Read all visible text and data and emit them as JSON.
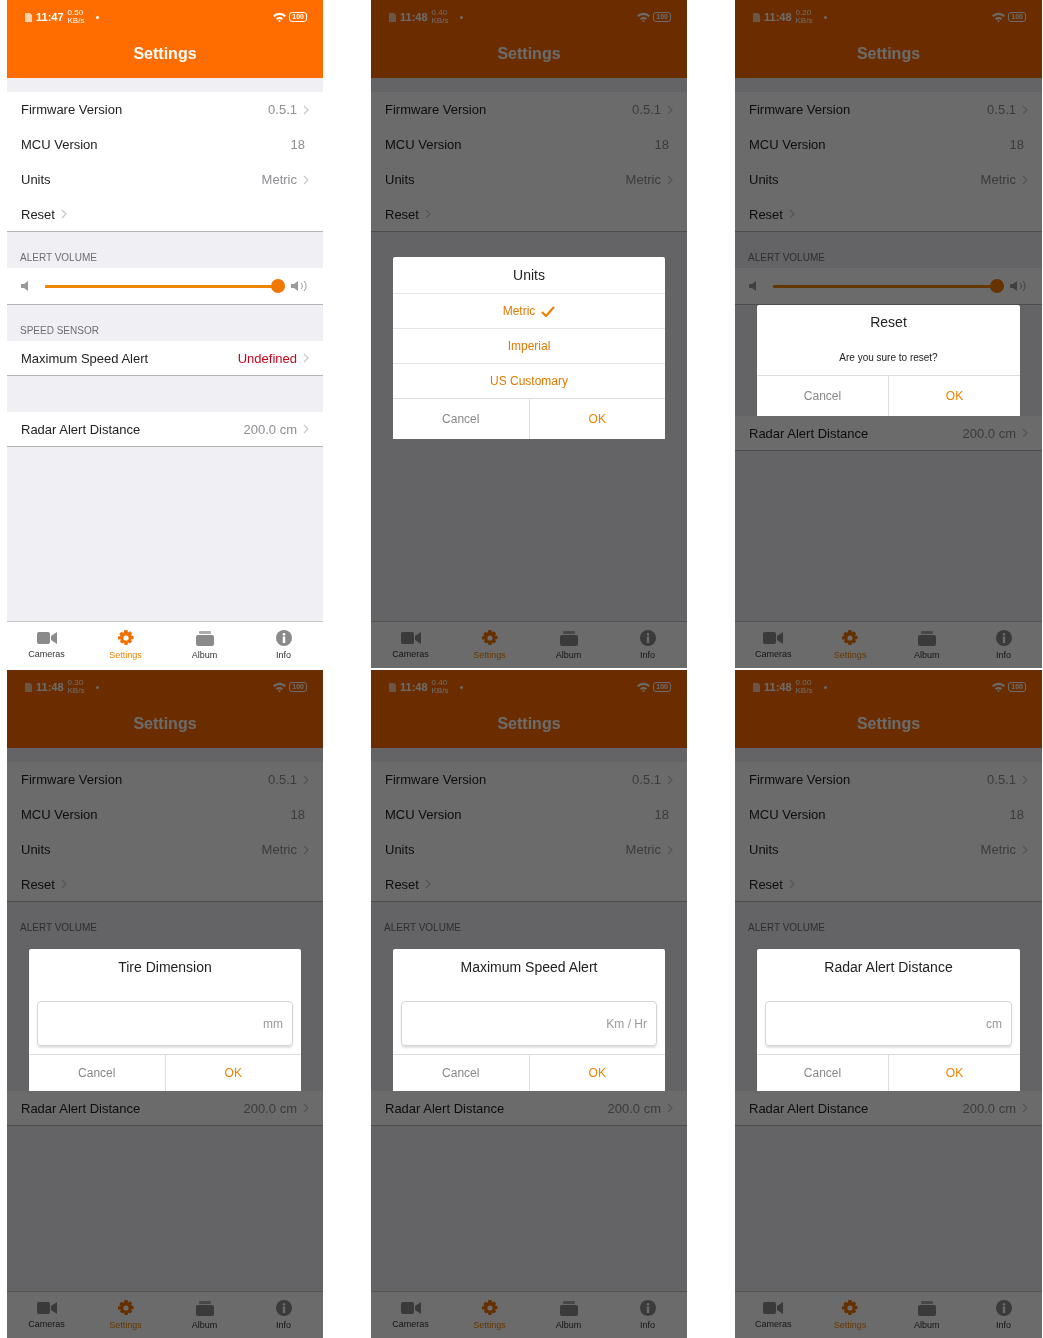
{
  "screens": [
    {
      "status_bar": {
        "time": "11:47",
        "speed": "0.50",
        "speed_unit": "KB/s",
        "battery": "100"
      },
      "title": "Settings",
      "dimmed": false,
      "body": [
        {
          "kind": "row",
          "label": "Firmware Version",
          "value": "0.5.1",
          "chevron": true
        },
        {
          "kind": "row",
          "label": "MCU Version",
          "value": "18",
          "chevron": false
        },
        {
          "kind": "row",
          "label": "Units",
          "value": "Metric",
          "chevron": true
        },
        {
          "kind": "row",
          "label": "Reset",
          "chevron": true
        },
        {
          "kind": "header",
          "label": "ALERT VOLUME"
        },
        {
          "kind": "slider",
          "level": 1
        },
        {
          "kind": "header",
          "label": "SPEED SENSOR"
        },
        {
          "kind": "row",
          "label": "Maximum Speed Alert",
          "value": "Undefined",
          "chevron": true,
          "warning": true
        },
        {
          "kind": "gap"
        },
        {
          "kind": "row",
          "label": "Radar Alert Distance",
          "value": "200.0 cm",
          "chevron": true
        }
      ],
      "tabs": [
        {
          "label": "Cameras",
          "kind": "camera",
          "selected": false
        },
        {
          "label": "Settings",
          "kind": "gear",
          "selected": true
        },
        {
          "label": "Album",
          "kind": "album",
          "selected": false
        },
        {
          "label": "Info",
          "kind": "info",
          "selected": false
        }
      ]
    },
    {
      "status_bar": {
        "time": "11:48",
        "speed": "0.40",
        "speed_unit": "KB/s",
        "battery": "100"
      },
      "title": "Settings",
      "dimmed": true,
      "body": [
        {
          "kind": "row",
          "label": "Firmware Version",
          "value": "0.5.1",
          "chevron": true
        },
        {
          "kind": "row",
          "label": "MCU Version",
          "value": "18",
          "chevron": false
        },
        {
          "kind": "row",
          "label": "Units",
          "value": "Metric",
          "chevron": true
        },
        {
          "kind": "row",
          "label": "Reset",
          "chevron": true
        },
        {
          "kind": "choice_dialog",
          "title": "Units",
          "options": [
            {
              "label": "Metric",
              "selected": true
            },
            {
              "label": "Imperial",
              "selected": false
            },
            {
              "label": "US Customary",
              "selected": false
            }
          ],
          "buttons": [
            {
              "label": "Cancel",
              "kind": "cancel"
            },
            {
              "label": "OK",
              "kind": "ok"
            }
          ]
        }
      ],
      "tabs": [
        {
          "label": "Cameras",
          "kind": "camera",
          "selected": false
        },
        {
          "label": "Settings",
          "kind": "gear",
          "selected": true
        },
        {
          "label": "Album",
          "kind": "album",
          "selected": false
        },
        {
          "label": "Info",
          "kind": "info",
          "selected": false
        }
      ]
    },
    {
      "status_bar": {
        "time": "11:48",
        "speed": "0.20",
        "speed_unit": "KB/s",
        "battery": "100"
      },
      "title": "Settings",
      "dimmed": true,
      "body": [
        {
          "kind": "row",
          "label": "Firmware Version",
          "value": "0.5.1",
          "chevron": true
        },
        {
          "kind": "row",
          "label": "MCU Version",
          "value": "18",
          "chevron": false
        },
        {
          "kind": "row",
          "label": "Units",
          "value": "Metric",
          "chevron": true
        },
        {
          "kind": "row",
          "label": "Reset",
          "chevron": true
        },
        {
          "kind": "header",
          "label": "ALERT VOLUME"
        },
        {
          "kind": "slider",
          "level": 1
        },
        {
          "kind": "confirm_dialog",
          "title": "Reset",
          "message": "Are you sure to reset?",
          "buttons": [
            {
              "label": "Cancel",
              "kind": "cancel"
            },
            {
              "label": "OK",
              "kind": "ok"
            }
          ]
        },
        {
          "kind": "row",
          "label": "Radar Alert Distance",
          "value": "200.0 cm",
          "chevron": true
        }
      ],
      "tabs": [
        {
          "label": "Cameras",
          "kind": "camera",
          "selected": false
        },
        {
          "label": "Settings",
          "kind": "gear",
          "selected": true
        },
        {
          "label": "Album",
          "kind": "album",
          "selected": false
        },
        {
          "label": "Info",
          "kind": "info",
          "selected": false
        }
      ]
    },
    {
      "status_bar": {
        "time": "11:48",
        "speed": "0.30",
        "speed_unit": "KB/s",
        "battery": "100"
      },
      "title": "Settings",
      "dimmed": true,
      "body": [
        {
          "kind": "row",
          "label": "Firmware Version",
          "value": "0.5.1",
          "chevron": true
        },
        {
          "kind": "row",
          "label": "MCU Version",
          "value": "18",
          "chevron": false
        },
        {
          "kind": "row",
          "label": "Units",
          "value": "Metric",
          "chevron": true
        },
        {
          "kind": "row",
          "label": "Reset",
          "chevron": true
        },
        {
          "kind": "header",
          "label": "ALERT VOLUME"
        },
        {
          "kind": "input_dialog",
          "title": "Tire Dimension",
          "unit": "mm",
          "buttons": [
            {
              "label": "Cancel",
              "kind": "cancel"
            },
            {
              "label": "OK",
              "kind": "ok"
            }
          ]
        },
        {
          "kind": "row",
          "label": "Radar Alert Distance",
          "value": "200.0 cm",
          "chevron": true
        }
      ],
      "tabs": [
        {
          "label": "Cameras",
          "kind": "camera",
          "selected": false
        },
        {
          "label": "Settings",
          "kind": "gear",
          "selected": true
        },
        {
          "label": "Album",
          "kind": "album",
          "selected": false
        },
        {
          "label": "Info",
          "kind": "info",
          "selected": false
        }
      ]
    },
    {
      "status_bar": {
        "time": "11:48",
        "speed": "0.40",
        "speed_unit": "KB/s",
        "battery": "100"
      },
      "title": "Settings",
      "dimmed": true,
      "body": [
        {
          "kind": "row",
          "label": "Firmware Version",
          "value": "0.5.1",
          "chevron": true
        },
        {
          "kind": "row",
          "label": "MCU Version",
          "value": "18",
          "chevron": false
        },
        {
          "kind": "row",
          "label": "Units",
          "value": "Metric",
          "chevron": true
        },
        {
          "kind": "row",
          "label": "Reset",
          "chevron": true
        },
        {
          "kind": "header",
          "label": "ALERT VOLUME"
        },
        {
          "kind": "input_dialog",
          "title": "Maximum Speed Alert",
          "unit": "Km / Hr",
          "buttons": [
            {
              "label": "Cancel",
              "kind": "cancel"
            },
            {
              "label": "OK",
              "kind": "ok"
            }
          ]
        },
        {
          "kind": "row",
          "label": "Radar Alert Distance",
          "value": "200.0 cm",
          "chevron": true
        }
      ],
      "tabs": [
        {
          "label": "Cameras",
          "kind": "camera",
          "selected": false
        },
        {
          "label": "Settings",
          "kind": "gear",
          "selected": true
        },
        {
          "label": "Album",
          "kind": "album",
          "selected": false
        },
        {
          "label": "Info",
          "kind": "info",
          "selected": false
        }
      ]
    },
    {
      "status_bar": {
        "time": "11:48",
        "speed": "0.00",
        "speed_unit": "KB/s",
        "battery": "100"
      },
      "title": "Settings",
      "dimmed": true,
      "body": [
        {
          "kind": "row",
          "label": "Firmware Version",
          "value": "0.5.1",
          "chevron": true
        },
        {
          "kind": "row",
          "label": "MCU Version",
          "value": "18",
          "chevron": false
        },
        {
          "kind": "row",
          "label": "Units",
          "value": "Metric",
          "chevron": true
        },
        {
          "kind": "row",
          "label": "Reset",
          "chevron": true
        },
        {
          "kind": "header",
          "label": "ALERT VOLUME"
        },
        {
          "kind": "input_dialog",
          "title": "Radar Alert Distance",
          "unit": "cm",
          "buttons": [
            {
              "label": "Cancel",
              "kind": "cancel"
            },
            {
              "label": "OK",
              "kind": "ok"
            }
          ]
        },
        {
          "kind": "row",
          "label": "Radar Alert Distance",
          "value": "200.0 cm",
          "chevron": true
        }
      ],
      "tabs": [
        {
          "label": "Cameras",
          "kind": "camera",
          "selected": false
        },
        {
          "label": "Settings",
          "kind": "gear",
          "selected": true
        },
        {
          "label": "Album",
          "kind": "album",
          "selected": false
        },
        {
          "label": "Info",
          "kind": "info",
          "selected": false
        }
      ]
    }
  ]
}
